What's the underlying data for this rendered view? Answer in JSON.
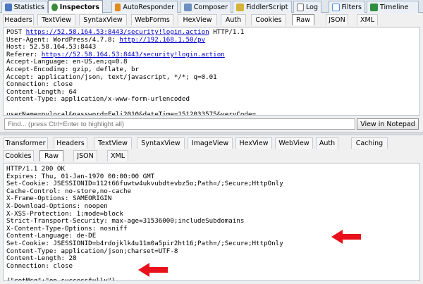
{
  "top_tabs": [
    {
      "label": "Statistics",
      "color": "#4a78c2"
    },
    {
      "label": "Inspectors",
      "color": "#3c8c3c"
    },
    {
      "label": "AutoResponder",
      "color": "#e08a1e"
    },
    {
      "label": "Composer",
      "color": "#6f8fbf"
    },
    {
      "label": "FiddlerScript",
      "color": "#d7b13a"
    },
    {
      "label": "Log",
      "color": "#6f6f6f"
    },
    {
      "label": "Filters",
      "color": "#4a90d9"
    },
    {
      "label": "Timeline",
      "color": "#2d8f3f"
    }
  ],
  "request": {
    "tabs": [
      "Headers",
      "TextView",
      "SyntaxView",
      "WebForms",
      "HexView",
      "Auth",
      "Cookies",
      "Raw",
      "JSON",
      "XML"
    ],
    "active_tab": "Raw",
    "lines": [
      {
        "pre": "POST ",
        "link": "https://52.58.164.53:8443/security!login.action",
        "post": " HTTP/1.1"
      },
      {
        "pre": "User-Agent: WordPress/4.7.8; ",
        "link": "http://192.168.1.50/pv",
        "post": ""
      },
      {
        "pre": "Host: 52.58.164.53:8443",
        "link": "",
        "post": ""
      },
      {
        "pre": "Referer: ",
        "link": "https://52.58.164.53:8443/security!login.action",
        "post": ""
      },
      {
        "pre": "Accept-Language: en-US,en;q=0.8",
        "link": "",
        "post": ""
      },
      {
        "pre": "Accept-Encoding: gzip, deflate, br",
        "link": "",
        "post": ""
      },
      {
        "pre": "Accept: application/json, text/javascript, */*; q=0.01",
        "link": "",
        "post": ""
      },
      {
        "pre": "Connection: close",
        "link": "",
        "post": ""
      },
      {
        "pre": "Content-Length: 64",
        "link": "",
        "post": ""
      },
      {
        "pre": "Content-Type: application/x-www-form-urlencoded",
        "link": "",
        "post": ""
      },
      {
        "pre": "",
        "link": "",
        "post": ""
      },
      {
        "pre": "userName=pvlocal&password=Feli2010&dateTime=1512033575&veryCode=",
        "link": "",
        "post": ""
      }
    ]
  },
  "find": {
    "placeholder": "Find... (press Ctrl+Enter to highlight all)",
    "button_label": "View in Notepad"
  },
  "response": {
    "tabs_row1": [
      "Transformer",
      "Headers",
      "TextView",
      "SyntaxView",
      "ImageView",
      "HexView",
      "WebView",
      "Auth",
      "Caching"
    ],
    "tabs_row2": [
      "Cookies",
      "Raw",
      "JSON",
      "XML"
    ],
    "active_tab": "Raw",
    "lines": [
      "HTTP/1.1 200 OK",
      "Expires: Thu, 01-Jan-1970 00:00:00 GMT",
      "Set-Cookie: JSESSIONID=112t66fuwtw4ukvubdtevbz5o;Path=/;Secure;HttpOnly",
      "Cache-Control: no-store,no-cache",
      "X-Frame-Options: SAMEORIGIN",
      "X-Download-Options: noopen",
      "X-XSS-Protection: 1;mode=block",
      "Strict-Transport-Security: max-age=31536000;includeSubdomains",
      "X-Content-Type-Options: nosniff",
      "Content-Language: de-DE",
      "Set-Cookie: JSESSIONID=b4rdojklk4u11m0a5pir2ht16;Path=/;Secure;HttpOnly",
      "Content-Type: application/json;charset=UTF-8",
      "Content-Length: 28",
      "Connection: close",
      "",
      "{\"retMsg\":\"op.successfully\"}"
    ]
  },
  "annotation_color": "#e8101a"
}
